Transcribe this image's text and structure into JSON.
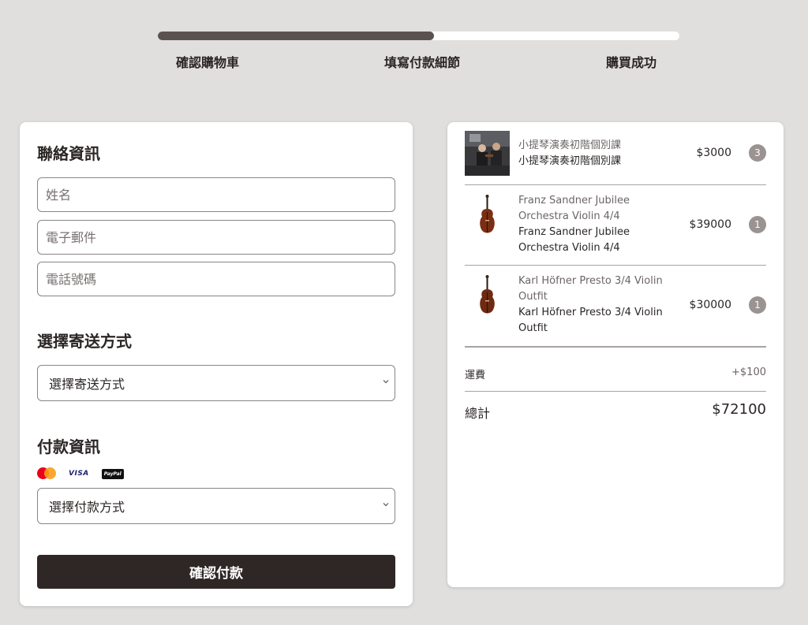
{
  "progress": {
    "value": 0.53,
    "track_color": "#ffffff",
    "fill_color": "#5a5150"
  },
  "steps": [
    "確認購物車",
    "填寫付款細節",
    "購買成功"
  ],
  "contact": {
    "title": "聯絡資訊",
    "name_placeholder": "姓名",
    "email_placeholder": "電子郵件",
    "phone_placeholder": "電話號碼"
  },
  "shipping": {
    "title": "選擇寄送方式",
    "select_value": "選擇寄送方式"
  },
  "payment": {
    "title": "付款資訊",
    "icons": [
      "mastercard-icon",
      "visa-icon",
      "paypal-icon"
    ],
    "visa_text": "VISA",
    "paypal_text": "PayPal",
    "select_value": "選擇付款方式"
  },
  "confirm_label": "確認付款",
  "cart": {
    "items": [
      {
        "name_grey": "小提琴演奏初階個別課",
        "name": "小提琴演奏初階個別課",
        "price": "$3000",
        "qty": "3",
        "thumb": "lesson-photo"
      },
      {
        "name_grey": "Franz Sandner Jubilee Orchestra Violin 4/4",
        "name": "Franz Sandner Jubilee Orchestra Violin 4/4",
        "price": "$39000",
        "qty": "1",
        "thumb": "violin-icon"
      },
      {
        "name_grey": "Karl Höfner Presto 3/4 Violin Outfit",
        "name": "Karl Höfner Presto 3/4 Violin Outfit",
        "price": "$30000",
        "qty": "1",
        "thumb": "violin-icon"
      }
    ],
    "shipping_label": "運費",
    "shipping_value": "+$100",
    "total_label": "總計",
    "total_value": "$72100"
  },
  "colors": {
    "background": "#e0dfdd",
    "button": "#2e2725",
    "badge": "#9a9392"
  }
}
